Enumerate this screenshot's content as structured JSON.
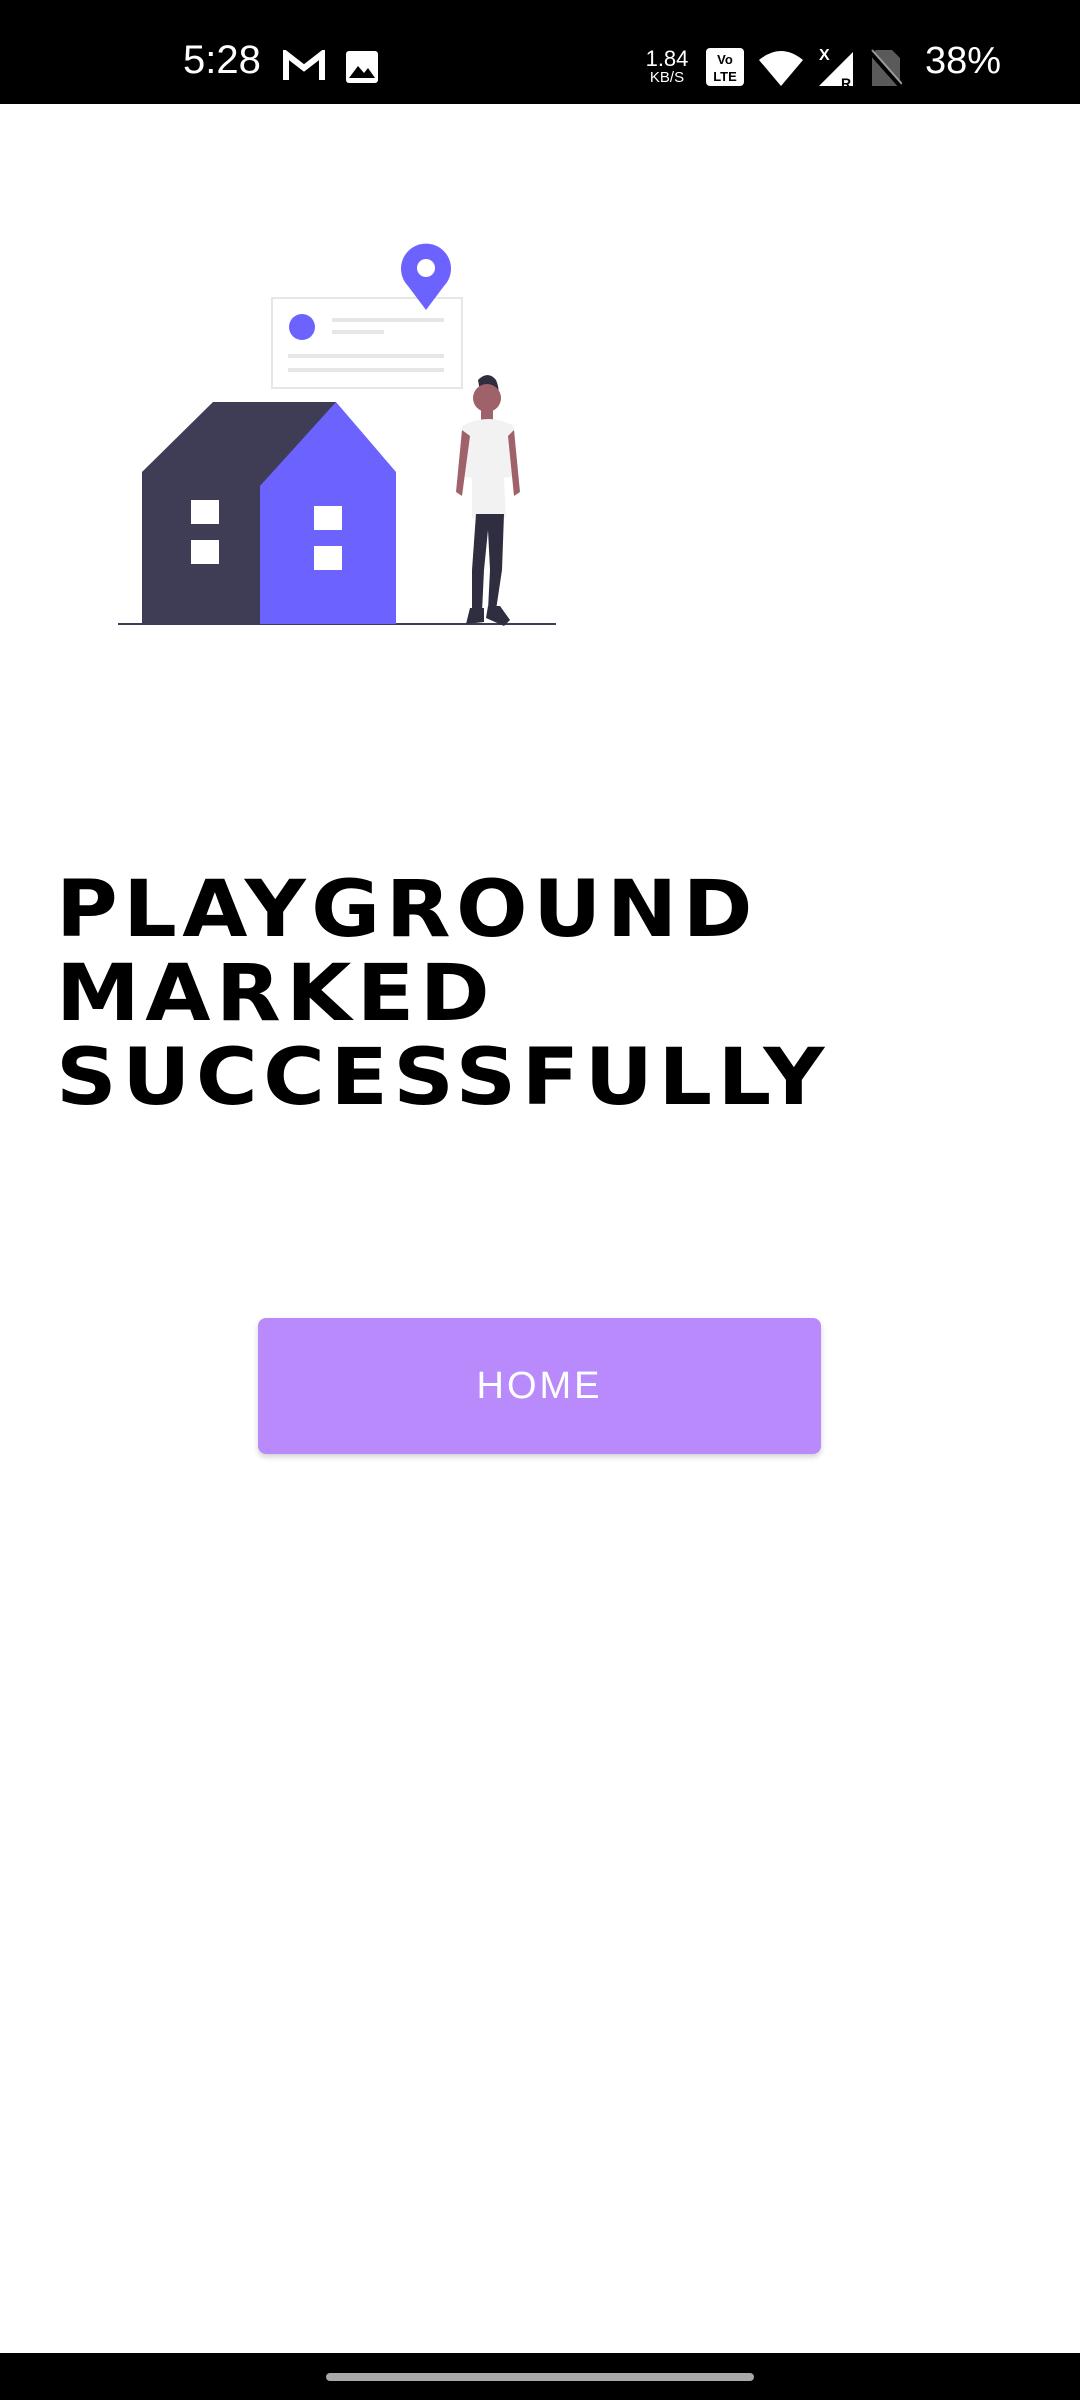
{
  "status_bar": {
    "time": "5:28",
    "net_speed_value": "1.84",
    "net_speed_unit": "KB/S",
    "volte_label": "Vo LTE",
    "signal_label": "R",
    "battery": "38%",
    "icons": [
      "gmail-icon",
      "gallery-icon",
      "volte-icon",
      "wifi-icon",
      "signal-icon",
      "no-sim-icon"
    ]
  },
  "illustration": {
    "description_icon": "house-with-person-location-illustration",
    "colors": {
      "house_dark": "#3f3d56",
      "house_accent": "#6c63ff",
      "pin": "#6c63ff"
    }
  },
  "headline": {
    "line1": "PLAYGROUND",
    "line2": "MARKED",
    "line3": "SUCCESSFULLY"
  },
  "home_button": {
    "label": "HOME",
    "color": "#b98afb"
  }
}
